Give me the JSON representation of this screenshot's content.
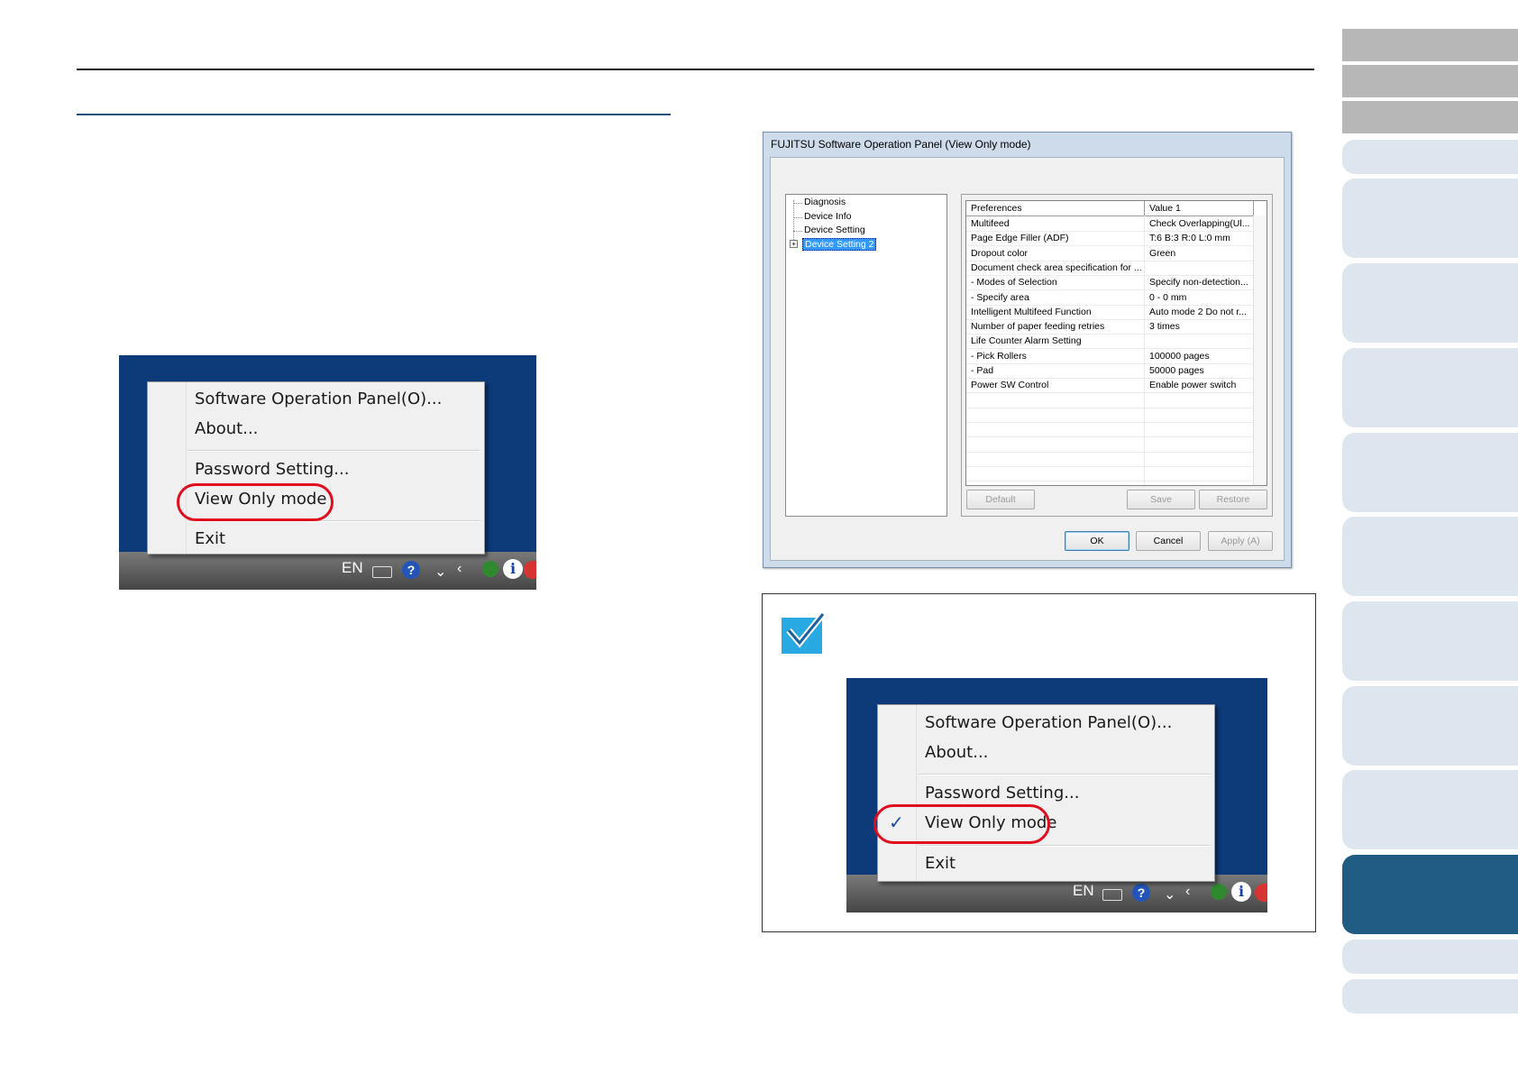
{
  "menu": {
    "items": [
      "Software Operation Panel(O)...",
      "About...",
      "Password Setting...",
      "View Only mode",
      "Exit"
    ]
  },
  "taskbar": {
    "lang": "EN",
    "icons": [
      "keyboard-icon",
      "help-icon",
      "expand-icon",
      "chevron-left-icon",
      "scanner-status-icon",
      "info-icon"
    ]
  },
  "dialog": {
    "title": "FUJITSU Software Operation Panel (View Only mode)",
    "tree": [
      "Diagnosis",
      "Device Info",
      "Device Setting",
      "Device Setting 2"
    ],
    "columns": [
      "Preferences",
      "Value 1"
    ],
    "rows": [
      {
        "pref": "Multifeed",
        "val": "Check Overlapping(Ul..."
      },
      {
        "pref": "Page Edge Filler (ADF)",
        "val": "T:6  B:3  R:0  L:0 mm"
      },
      {
        "pref": "Dropout color",
        "val": "Green"
      },
      {
        "pref": "Document check area specification for ...",
        "val": ""
      },
      {
        "pref": " - Modes of Selection",
        "val": "Specify non-detection..."
      },
      {
        "pref": " - Specify area",
        "val": "0 - 0 mm"
      },
      {
        "pref": "Intelligent Multifeed Function",
        "val": "Auto mode 2  Do not r..."
      },
      {
        "pref": "Number of paper feeding retries",
        "val": "3 times"
      },
      {
        "pref": "Life Counter Alarm Setting",
        "val": ""
      },
      {
        "pref": " - Pick Rollers",
        "val": "100000 pages"
      },
      {
        "pref": " - Pad",
        "val": "50000 pages"
      },
      {
        "pref": "Power SW Control",
        "val": "Enable power switch"
      },
      {
        "pref": "",
        "val": ""
      },
      {
        "pref": "",
        "val": ""
      },
      {
        "pref": "",
        "val": ""
      },
      {
        "pref": "",
        "val": ""
      },
      {
        "pref": "",
        "val": ""
      },
      {
        "pref": "",
        "val": ""
      }
    ],
    "buttons": {
      "default": "Default",
      "save": "Save",
      "restore": "Restore",
      "ok": "OK",
      "cancel": "Cancel",
      "apply": "Apply (A)"
    }
  },
  "colors": {
    "accent_rule": "#1f4e79",
    "highlight_ring": "#e00d1f",
    "desktop": "#0d3a78",
    "nav_active": "#1f5b82",
    "nav_light": "#dde5ee",
    "hint_icon": "#29a9e1"
  }
}
